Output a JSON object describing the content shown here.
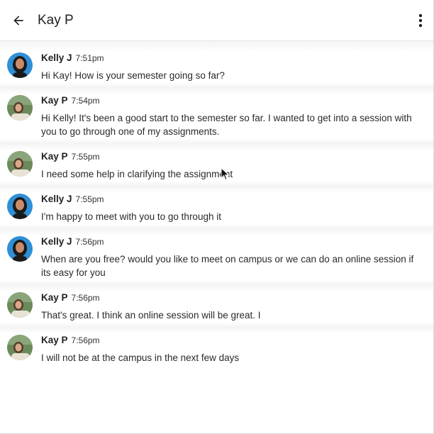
{
  "header": {
    "title": "Kay P",
    "back_icon": "arrow-left-icon",
    "menu_icon": "more-vertical-icon"
  },
  "messages": [
    {
      "sender": "Kelly J",
      "time": "7:51pm",
      "avatar": "kelly",
      "text": "Hi Kay! How is your semester going so far?"
    },
    {
      "sender": "Kay P",
      "time": "7:54pm",
      "avatar": "kay",
      "text": "Hi Kelly! It's been a good start to the semester so far. I wanted to get into a session with you to go through one of my assignments."
    },
    {
      "sender": "Kay P",
      "time": "7:55pm",
      "avatar": "kay",
      "text": "I need some help in clarifying the assignment"
    },
    {
      "sender": "Kelly J",
      "time": "7:55pm",
      "avatar": "kelly",
      "text": "I'm happy to meet with you to go through it"
    },
    {
      "sender": "Kelly J",
      "time": "7:56pm",
      "avatar": "kelly",
      "text": "When are you free? would you like to meet on campus or we can do an online session if its easy for you"
    },
    {
      "sender": "Kay P",
      "time": "7:56pm",
      "avatar": "kay",
      "text": "That's great. I think an online session will be great. I"
    },
    {
      "sender": "Kay P",
      "time": "7:56pm",
      "avatar": "kay",
      "text": "I will not be at the campus in the next few days"
    }
  ],
  "colors": {
    "kelly_avatar_bg": "#2f8fd6",
    "kay_avatar_bg": "#6b8a5a"
  }
}
